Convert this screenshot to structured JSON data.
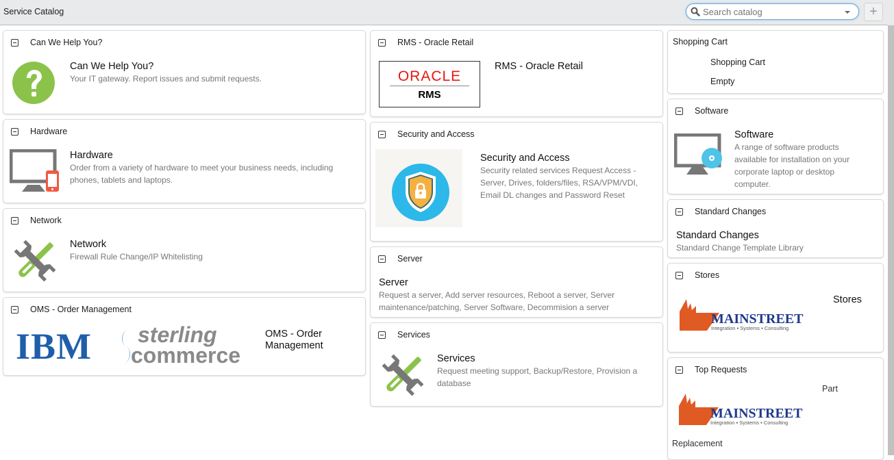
{
  "header": {
    "title": "Service Catalog",
    "search_placeholder": "Search catalog",
    "search_value": "",
    "add_label": "+"
  },
  "colors": {
    "accent_green": "#8bc34a",
    "icon_gray": "#777777",
    "phone_red": "#f05a40",
    "shield_blue": "#29b6e6",
    "oracle_red": "#e8170d",
    "ibm_blue": "#1f5faa",
    "mainstreet_orange": "#e05a24",
    "mainstreet_navy": "#1e3a8a"
  },
  "columns": {
    "left": [
      {
        "header": "Can We Help You?",
        "title": "Can We Help You?",
        "description": "Your IT gateway. Report issues and submit requests.",
        "icon": "help-question-icon"
      },
      {
        "header": "Hardware",
        "title": "Hardware",
        "description": "Order from a variety of hardware to meet your business needs, including phones, tablets and laptops.",
        "icon": "monitor-phone-icon"
      },
      {
        "header": "Network",
        "title": "Network",
        "description": "Firewall Rule Change/IP Whitelisting",
        "icon": "wrench-screwdriver-icon"
      },
      {
        "header": "OMS - Order Management",
        "title": "OMS - Order Management",
        "title_line1": "OMS - Order",
        "title_line2": "Management",
        "icon": "ibm-sterling-logo",
        "logo_text_ibm": "IBM",
        "logo_text_sterling1": "sterling",
        "logo_text_sterling2": "commerce"
      }
    ],
    "middle": [
      {
        "header": "RMS - Oracle Retail",
        "title": "RMS - Oracle Retail",
        "icon": "oracle-rms-logo",
        "logo_oracle": "ORACLE",
        "logo_rms": "RMS"
      },
      {
        "header": "Security and Access",
        "title": "Security and Access",
        "description": "Security related services Request Access - Server, Drives, folders/files, RSA/VPM/VDI, Email DL changes and Password Reset",
        "icon": "shield-lock-icon"
      },
      {
        "header": "Server",
        "title": "Server",
        "description": "Request a server, Add server resources, Reboot a server, Server maintenance/patching, Server Software, Decommision a server"
      },
      {
        "header": "Services",
        "title": "Services",
        "description": "Request meeting support, Backup/Restore, Provision a database",
        "icon": "wrench-screwdriver-icon"
      }
    ],
    "right": [
      {
        "header": "Shopping Cart",
        "title": "Shopping Cart",
        "status": "Empty"
      },
      {
        "header": "Software",
        "title": "Software",
        "description": "A range of software products available for installation on your corporate laptop or desktop computer.",
        "icon": "monitor-disc-icon"
      },
      {
        "header": "Standard Changes",
        "title": "Standard Changes",
        "description": "Standard Change Template Library"
      },
      {
        "header": "Stores",
        "title": "Stores",
        "icon": "mainstreet-logo",
        "logo_text": "MAINSTREET",
        "logo_tagline": "Integration ▪ Systems ▪ Consulting"
      },
      {
        "header": "Top Requests",
        "item_part1": "Part",
        "item_part2": "Replacement",
        "icon": "mainstreet-logo",
        "logo_text": "MAINSTREET",
        "logo_tagline": "Integration ▪ Systems ▪ Consulting"
      }
    ]
  }
}
